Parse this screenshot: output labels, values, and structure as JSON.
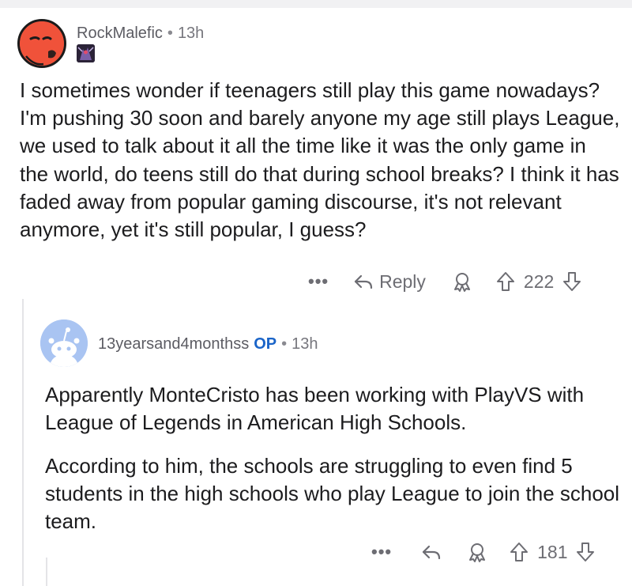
{
  "comments": [
    {
      "username": "RockMalefic",
      "separator": "•",
      "time": "13h",
      "avatar": "red-snoo-avatar-icon",
      "flair": "champion-flair-icon",
      "body": "I sometimes wonder if teenagers still play this game nowadays? I'm pushing 30 soon and barely anyone my age still plays League, we used to talk about it all the time like it was the only game in the world, do teens still do that during school breaks? I think it has faded away from popular gaming discourse, it's not relevant anymore, yet it's still popular, I guess?",
      "actions": {
        "more": "•••",
        "reply_label": "Reply",
        "score": "222"
      }
    },
    {
      "username": "13yearsand4monthss",
      "op_badge": "OP",
      "separator": "•",
      "time": "13h",
      "avatar": "default-blue-snoo-avatar-icon",
      "paragraphs": [
        "Apparently MonteCristo has been working with PlayVS with League of Legends in American High Schools.",
        "According to him, the schools are struggling to even find 5 students in the high schools who play League to join the school team."
      ],
      "actions": {
        "more": "•••",
        "score": "181"
      }
    }
  ],
  "colors": {
    "avatar1": "#f0523a",
    "avatar2": "#a9c4f2",
    "op_badge": "#1a64c8",
    "meta_text": "#76767d"
  }
}
